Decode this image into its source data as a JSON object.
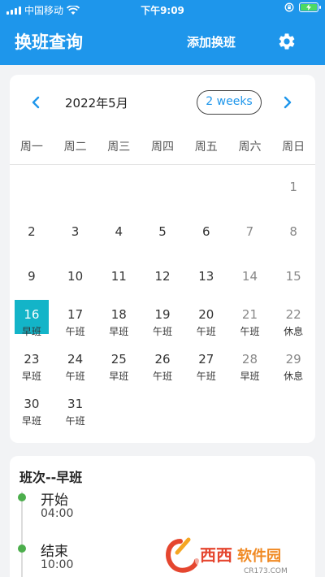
{
  "status_bar": {
    "carrier": "中国移动",
    "time": "下午9:09",
    "battery_level": 1.0
  },
  "header": {
    "title": "换班查询",
    "add_label": "添加换班",
    "settings_icon": "gear-icon"
  },
  "calendar": {
    "month_title": "2022年5月",
    "format_button": "2 weeks",
    "weekdays": [
      "周一",
      "周二",
      "周三",
      "周四",
      "周五",
      "周六",
      "周日"
    ],
    "today": "16",
    "weeks": [
      [
        {
          "day": "",
          "shift": ""
        },
        {
          "day": "",
          "shift": ""
        },
        {
          "day": "",
          "shift": ""
        },
        {
          "day": "",
          "shift": ""
        },
        {
          "day": "",
          "shift": ""
        },
        {
          "day": "",
          "shift": ""
        },
        {
          "day": "1",
          "shift": ""
        }
      ],
      [
        {
          "day": "2",
          "shift": ""
        },
        {
          "day": "3",
          "shift": ""
        },
        {
          "day": "4",
          "shift": ""
        },
        {
          "day": "5",
          "shift": ""
        },
        {
          "day": "6",
          "shift": ""
        },
        {
          "day": "7",
          "shift": ""
        },
        {
          "day": "8",
          "shift": ""
        }
      ],
      [
        {
          "day": "9",
          "shift": ""
        },
        {
          "day": "10",
          "shift": ""
        },
        {
          "day": "11",
          "shift": ""
        },
        {
          "day": "12",
          "shift": ""
        },
        {
          "day": "13",
          "shift": ""
        },
        {
          "day": "14",
          "shift": ""
        },
        {
          "day": "15",
          "shift": ""
        }
      ],
      [
        {
          "day": "16",
          "shift": "早班"
        },
        {
          "day": "17",
          "shift": "午班"
        },
        {
          "day": "18",
          "shift": "早班"
        },
        {
          "day": "19",
          "shift": "午班"
        },
        {
          "day": "20",
          "shift": "午班"
        },
        {
          "day": "21",
          "shift": "午班"
        },
        {
          "day": "22",
          "shift": "休息"
        }
      ],
      [
        {
          "day": "23",
          "shift": "早班"
        },
        {
          "day": "24",
          "shift": "午班"
        },
        {
          "day": "25",
          "shift": "早班"
        },
        {
          "day": "26",
          "shift": "午班"
        },
        {
          "day": "27",
          "shift": "午班"
        },
        {
          "day": "28",
          "shift": "早班"
        },
        {
          "day": "29",
          "shift": "休息"
        }
      ],
      [
        {
          "day": "30",
          "shift": "早班"
        },
        {
          "day": "31",
          "shift": "午班"
        },
        {
          "day": "",
          "shift": ""
        },
        {
          "day": "",
          "shift": ""
        },
        {
          "day": "",
          "shift": ""
        },
        {
          "day": "",
          "shift": ""
        },
        {
          "day": "",
          "shift": ""
        }
      ]
    ]
  },
  "detail": {
    "title": "班次--早班",
    "events": [
      {
        "label": "开始",
        "time": "04:00"
      },
      {
        "label": "结束",
        "time": "10:00"
      }
    ]
  },
  "watermark": {
    "brand": "西西软件园",
    "url": "CR173.COM"
  },
  "colors": {
    "primary": "#1e96eb",
    "today": "#13b4c8",
    "timeline_dot": "#4cae4c"
  }
}
